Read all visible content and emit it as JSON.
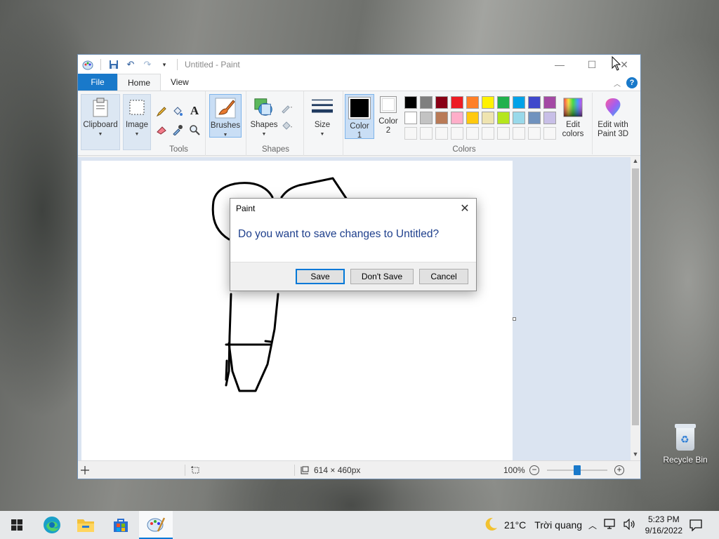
{
  "window": {
    "title": "Untitled - Paint",
    "minimize": "—",
    "maximize": "☐",
    "close": "✕"
  },
  "tabs": [
    {
      "label": "File"
    },
    {
      "label": "Home"
    },
    {
      "label": "View"
    }
  ],
  "ribbon": {
    "clipboard": "Clipboard",
    "image": "Image",
    "tools_group": "Tools",
    "brushes": "Brushes",
    "shapes": "Shapes",
    "shapes_group": "Shapes",
    "size": "Size",
    "color1_line1": "Color",
    "color1_line2": "1",
    "color2_line1": "Color",
    "color2_line2": "2",
    "colors_group": "Colors",
    "edit_colors_line1": "Edit",
    "edit_colors_line2": "colors",
    "paint3d_line1": "Edit with",
    "paint3d_line2": "Paint 3D",
    "text_tool": "A"
  },
  "palette": {
    "row1": [
      "#000000",
      "#7f7f7f",
      "#880015",
      "#ed1c24",
      "#ff7f27",
      "#fff200",
      "#22b14c",
      "#00a2e8",
      "#3f48cc",
      "#a349a4"
    ],
    "row2": [
      "#ffffff",
      "#c3c3c3",
      "#b97a57",
      "#ffaec9",
      "#ffc90e",
      "#efe4b0",
      "#b5e61d",
      "#99d9ea",
      "#7092be",
      "#c8bfe7"
    ]
  },
  "colors": {
    "color1": "#000000",
    "color2": "#ffffff",
    "accent": "#1979ca"
  },
  "statusbar": {
    "canvas_size": "614 × 460px",
    "zoom": "100%",
    "zoom_out": "−",
    "zoom_in": "+"
  },
  "dialog": {
    "title": "Paint",
    "message": "Do you want to save changes to Untitled?",
    "save": "Save",
    "dont_save": "Don't Save",
    "cancel": "Cancel",
    "close": "✕"
  },
  "desktop": {
    "recycle_bin": "Recycle Bin"
  },
  "taskbar": {
    "weather_temp": "21°C",
    "weather_desc": "Trời quang",
    "time": "5:23 PM",
    "date": "9/16/2022"
  },
  "icons": [
    "windows-start-icon",
    "edge-icon",
    "file-explorer-icon",
    "store-icon",
    "paint-icon",
    "moon-icon",
    "chevron-up-icon",
    "network-icon",
    "volume-icon",
    "notification-icon"
  ]
}
